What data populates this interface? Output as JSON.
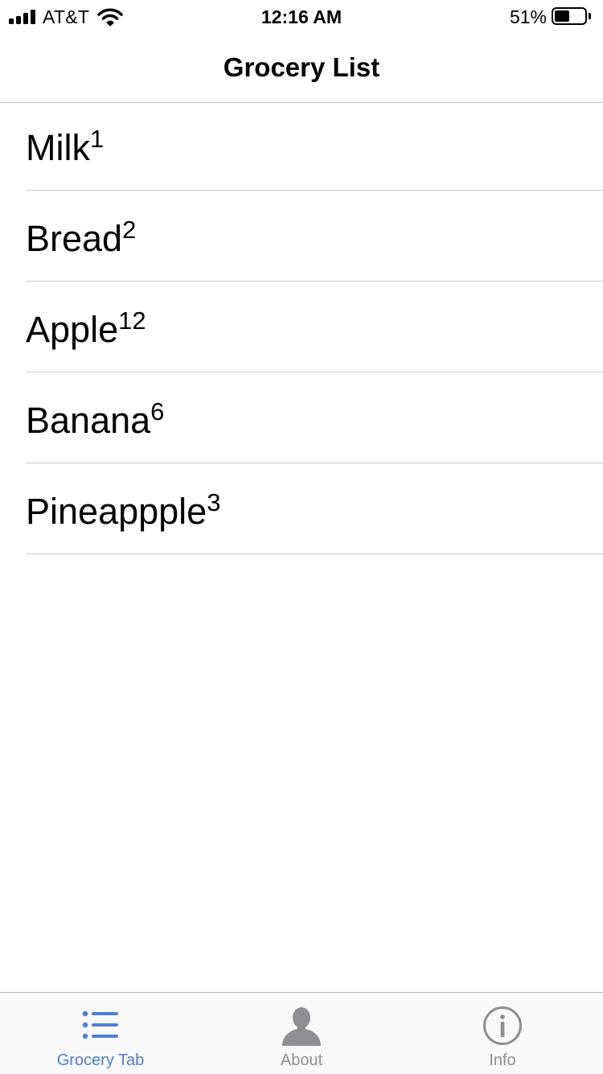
{
  "status_bar": {
    "carrier": "AT&T",
    "time": "12:16 AM",
    "battery_percent": "51%",
    "battery_level": 0.51,
    "signal_icon": "cellular-signal-icon",
    "wifi_icon": "wifi-icon",
    "battery_icon": "battery-icon"
  },
  "nav": {
    "title": "Grocery List"
  },
  "grocery_items": [
    {
      "name": "Milk",
      "quantity": "1"
    },
    {
      "name": "Bread",
      "quantity": "2"
    },
    {
      "name": "Apple",
      "quantity": "12"
    },
    {
      "name": "Banana",
      "quantity": "6"
    },
    {
      "name": "Pineappple",
      "quantity": "3"
    }
  ],
  "tab_bar": {
    "tabs": [
      {
        "label": "Grocery Tab",
        "icon": "list-icon",
        "selected": true
      },
      {
        "label": "About",
        "icon": "person-icon",
        "selected": false
      },
      {
        "label": "Info",
        "icon": "info-icon",
        "selected": false
      }
    ],
    "active_color": "#4a7fe0",
    "inactive_color": "#8e8e93"
  }
}
